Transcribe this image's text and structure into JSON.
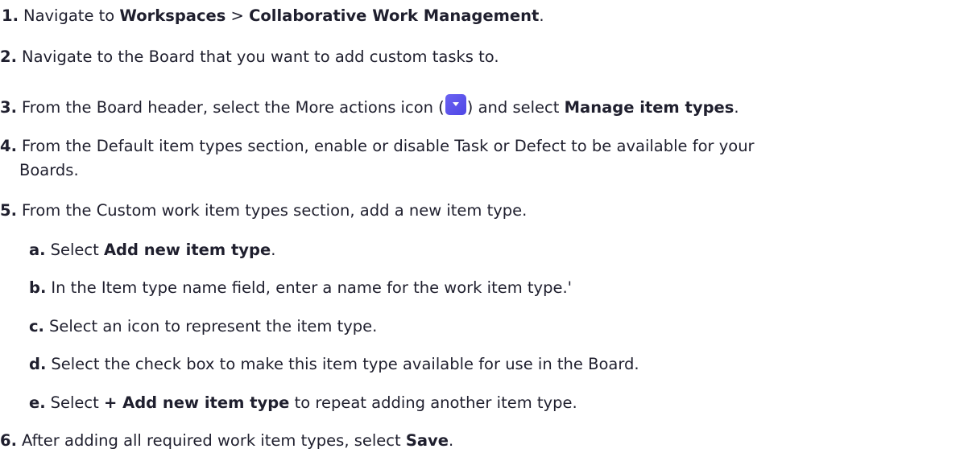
{
  "steps": [
    {
      "num": "1.",
      "t1": "Navigate to ",
      "b1": "Workspaces",
      "t2": " > ",
      "b2": "Collaborative Work Management",
      "t3": "."
    },
    {
      "num": "2.",
      "text": "Navigate to the Board that you want to add custom tasks to."
    },
    {
      "num": "3.",
      "t1": "From the Board header, select the More actions icon (",
      "icon": "more-actions-chevron-icon",
      "t2": ") and select ",
      "b1": "Manage item types",
      "t3": "."
    },
    {
      "num": "4.",
      "line1": "From the Default item types section, enable or disable Task or Defect to be available for your",
      "line2": "Boards."
    },
    {
      "num": "5.",
      "text": "From the Custom work item types section, add a new item type.",
      "substeps": [
        {
          "letter": "a.",
          "t1": "Select ",
          "b1": "Add new item type",
          "t2": "."
        },
        {
          "letter": "b.",
          "text": "In the Item type name field, enter a name for the work item type.'"
        },
        {
          "letter": "c.",
          "text": "Select an icon to represent the item type."
        },
        {
          "letter": "d.",
          "text": "Select the check box to make this item type available for use in the Board."
        },
        {
          "letter": "e.",
          "t1": "Select ",
          "b1": "+ Add new item type",
          "t2": " to repeat adding another item type."
        }
      ]
    },
    {
      "num": "6.",
      "t1": "After adding all required work item types, select ",
      "b1": "Save",
      "t2": "."
    }
  ],
  "colors": {
    "text": "#1f1f2e",
    "icon_bg": "#5a52ef"
  }
}
